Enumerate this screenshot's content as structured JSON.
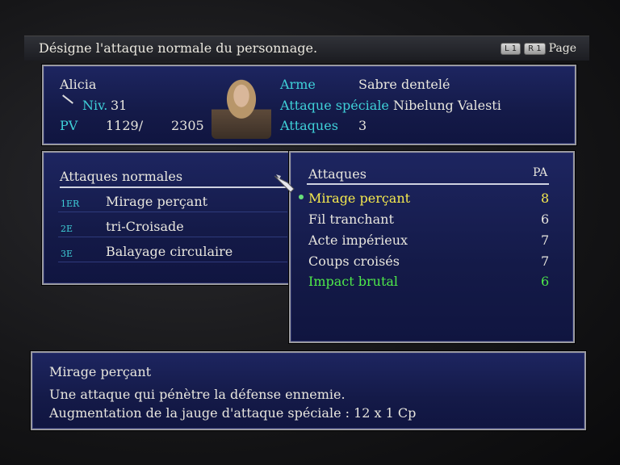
{
  "topbar": {
    "hint": "Désigne l'attaque normale du personnage.",
    "l1": "L 1",
    "r1": "R 1",
    "page": "Page"
  },
  "character": {
    "name": "Alicia",
    "level_label": "Niv.",
    "level": "31",
    "hp_label": "PV",
    "hp_current": "1129/",
    "hp_max": "2305",
    "weapon_label": "Arme",
    "weapon": "Sabre dentelé",
    "special_label": "Attaque spéciale",
    "special": "Nibelung Valesti",
    "attacks_label": "Attaques",
    "attacks_count": "3"
  },
  "normals": {
    "header": "Attaques normales",
    "rows": [
      {
        "slot": "1ER",
        "name": "Mirage perçant"
      },
      {
        "slot": "2E",
        "name": "tri-Croisade"
      },
      {
        "slot": "3E",
        "name": "Balayage circulaire"
      }
    ]
  },
  "attacks": {
    "header": "Attaques",
    "pa_header": "PA",
    "rows": [
      {
        "name": "Mirage perçant",
        "pa": "8"
      },
      {
        "name": "Fil tranchant",
        "pa": "6"
      },
      {
        "name": "Acte impérieux",
        "pa": "7"
      },
      {
        "name": "Coups croisés",
        "pa": "7"
      },
      {
        "name": "Impact brutal",
        "pa": "6"
      }
    ]
  },
  "description": {
    "title": "Mirage perçant",
    "line1": "Une attaque qui pénètre la défense ennemie.",
    "line2": "Augmentation de la jauge d'attaque spéciale : 12 x 1 Cp"
  },
  "colors": {
    "label_cyan": "#3fd0d8",
    "selected_yellow": "#f6ea4e",
    "special_green": "#4ee84a",
    "panel_blue": "#1a2258"
  }
}
